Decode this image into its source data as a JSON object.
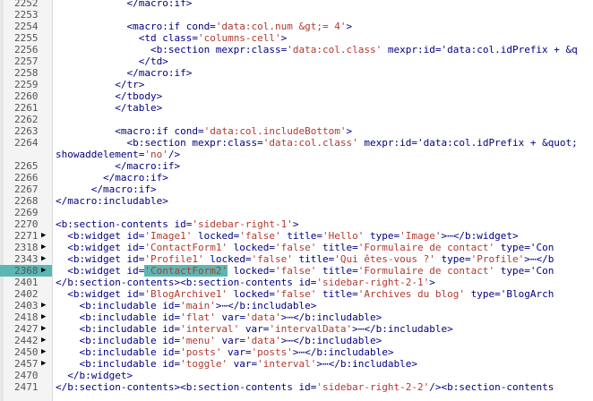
{
  "editor": {
    "lines": [
      {
        "n": "2252",
        "fold": "",
        "code": "            </macro:if>"
      },
      {
        "n": "2253",
        "fold": "",
        "code": ""
      },
      {
        "n": "2254",
        "fold": "",
        "code": "            <macro:if cond='data:col.num &gt;= 4'>"
      },
      {
        "n": "2255",
        "fold": "",
        "code": "              <td class='columns-cell'>"
      },
      {
        "n": "2256",
        "fold": "",
        "code": "                <b:section mexpr:class='data:col.class' mexpr:id='data:col.idPrefix + &q"
      },
      {
        "n": "2257",
        "fold": "",
        "code": "              </td>"
      },
      {
        "n": "2258",
        "fold": "",
        "code": "            </macro:if>"
      },
      {
        "n": "2259",
        "fold": "",
        "code": "          </tr>"
      },
      {
        "n": "2260",
        "fold": "",
        "code": "          </tbody>"
      },
      {
        "n": "2261",
        "fold": "",
        "code": "          </table>"
      },
      {
        "n": "2262",
        "fold": "",
        "code": ""
      },
      {
        "n": "2263",
        "fold": "",
        "code": "          <macro:if cond='data:col.includeBottom'>"
      },
      {
        "n": "2264",
        "fold": "",
        "code": "            <b:section mexpr:class='data:col.class' mexpr:id='data:col.idPrefix + &quot;"
      },
      {
        "n": "",
        "fold": "",
        "code": "showaddelement='no'/>"
      },
      {
        "n": "2265",
        "fold": "",
        "code": "          </macro:if>"
      },
      {
        "n": "2266",
        "fold": "",
        "code": "        </macro:if>"
      },
      {
        "n": "2267",
        "fold": "",
        "code": "      </macro:if>"
      },
      {
        "n": "2268",
        "fold": "",
        "code": "</macro:includable>"
      },
      {
        "n": "2269",
        "fold": "",
        "code": ""
      },
      {
        "n": "2270",
        "fold": "",
        "code": "<b:section-contents id='sidebar-right-1'>"
      },
      {
        "n": "2271",
        "fold": "▶",
        "code": "  <b:widget id='Image1' locked='false' title='Hello' type='Image'>⋯</b:widget>"
      },
      {
        "n": "2318",
        "fold": "▶",
        "code": "  <b:widget id='ContactForm1' locked='false' title='Formulaire de contact' type='Con"
      },
      {
        "n": "2343",
        "fold": "▶",
        "code": "  <b:widget id='Profile1' locked='false' title='Qui êtes-vous ?' type='Profile'>⋯</b"
      },
      {
        "n": "2368",
        "fold": "▶",
        "code": "  <b:widget id='ContactForm2' locked='false' title='Formulaire de contact' type='Con",
        "selected": true
      },
      {
        "n": "2401",
        "fold": "",
        "code": "</b:section-contents><b:section-contents id='sidebar-right-2-1'>"
      },
      {
        "n": "2402",
        "fold": "",
        "code": "  <b:widget id='BlogArchive1' locked='false' title='Archives du blog' type='BlogArch"
      },
      {
        "n": "2403",
        "fold": "▶",
        "code": "    <b:includable id='main'>⋯</b:includable>"
      },
      {
        "n": "2418",
        "fold": "▶",
        "code": "    <b:includable id='flat' var='data'>⋯</b:includable>"
      },
      {
        "n": "2427",
        "fold": "▶",
        "code": "    <b:includable id='interval' var='intervalData'>⋯</b:includable>"
      },
      {
        "n": "2442",
        "fold": "▶",
        "code": "    <b:includable id='menu' var='data'>⋯</b:includable>"
      },
      {
        "n": "2450",
        "fold": "▶",
        "code": "    <b:includable id='posts' var='posts'>⋯</b:includable>"
      },
      {
        "n": "2457",
        "fold": "▶",
        "code": "    <b:includable id='toggle' var='interval'>⋯</b:includable>"
      },
      {
        "n": "2470",
        "fold": "",
        "code": "  </b:widget>"
      },
      {
        "n": "2471",
        "fold": "",
        "code": "</b:section-contents><b:section-contents id='sidebar-right-2-2'/><b:section-contents"
      }
    ]
  }
}
